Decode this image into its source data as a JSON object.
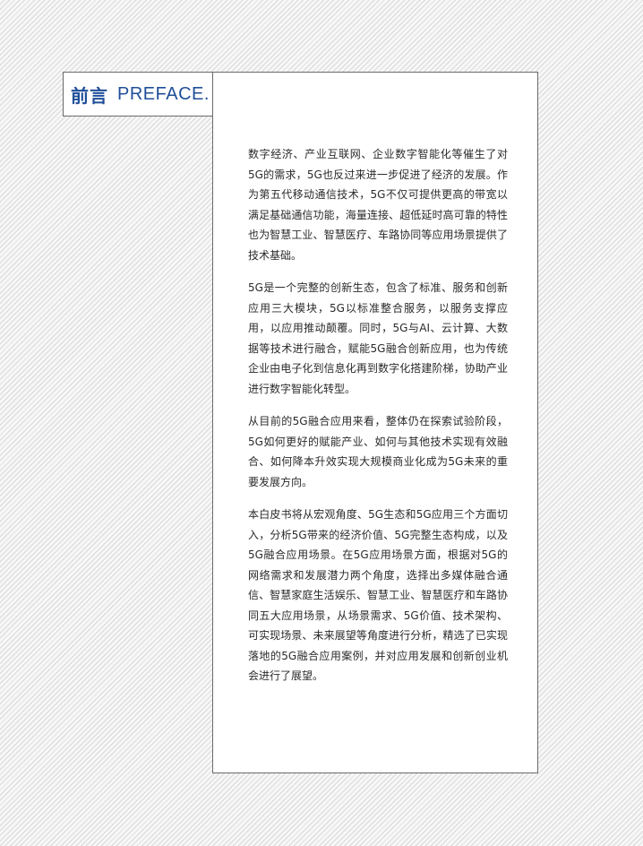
{
  "header": {
    "title_cn": "前言",
    "title_en": "PREFACE."
  },
  "paragraphs": [
    "数字经济、产业互联网、企业数字智能化等催生了对5G的需求，5G也反过来进一步促进了经济的发展。作为第五代移动通信技术，5G不仅可提供更高的带宽以满足基础通信功能，海量连接、超低延时高可靠的特性也为智慧工业、智慧医疗、车路协同等应用场景提供了技术基础。",
    "5G是一个完整的创新生态，包含了标准、服务和创新应用三大模块，5G以标准整合服务，以服务支撑应用，以应用推动颠覆。同时，5G与AI、云计算、大数据等技术进行融合，赋能5G融合创新应用，也为传统企业由电子化到信息化再到数字化搭建阶梯，协助产业进行数字智能化转型。",
    "从目前的5G融合应用来看，整体仍在探索试验阶段，5G如何更好的赋能产业、如何与其他技术实现有效融合、如何降本升效实现大规模商业化成为5G未来的重要发展方向。",
    "本白皮书将从宏观角度、5G生态和5G应用三个方面切入，分析5G带来的经济价值、5G完整生态构成，以及5G融合应用场景。在5G应用场景方面，根据对5G的网络需求和发展潜力两个角度，选择出多媒体融合通信、智慧家庭生活娱乐、智慧工业、智慧医疗和车路协同五大应用场景，从场景需求、5G价值、技术架构、可实现场景、未来展望等角度进行分析，精选了已实现落地的5G融合应用案例，并对应用发展和创新创业机会进行了展望。"
  ],
  "colors": {
    "accent": "#1f4e99",
    "text": "#2a2a2a",
    "border": "#6a6a6a"
  }
}
